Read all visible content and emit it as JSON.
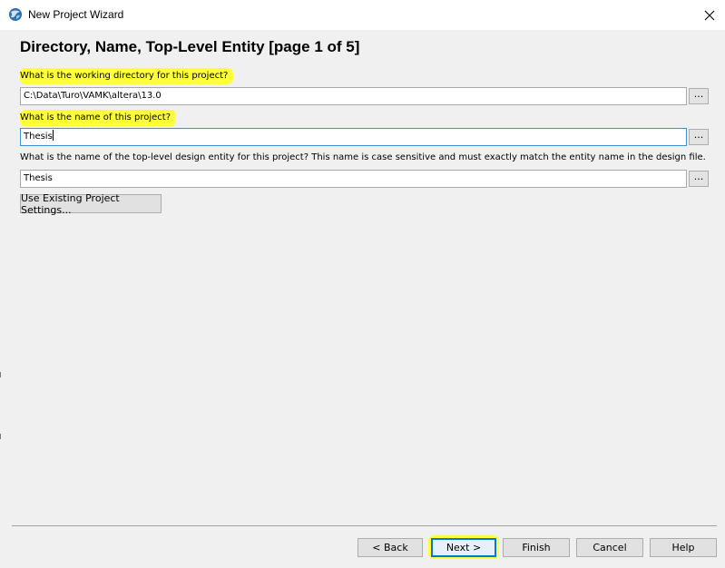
{
  "window": {
    "title": "New Project Wizard",
    "close_glyph": "✕"
  },
  "page": {
    "heading": "Directory, Name, Top-Level Entity [page 1 of 5]"
  },
  "fields": {
    "working_dir": {
      "label": "What is the working directory for this project?",
      "value": "C:\\Data\\Turo\\VAMK\\altera\\13.0",
      "browse_label": "..."
    },
    "project_name": {
      "label": "What is the name of this project?",
      "value": "Thesis",
      "browse_label": "..."
    },
    "top_entity": {
      "label": "What is the name of the top-level design entity for this project? This name is case sensitive and must exactly match the entity name in the design file.",
      "value": "Thesis",
      "browse_label": "..."
    }
  },
  "actions": {
    "use_existing": "Use Existing Project Settings..."
  },
  "footer": {
    "back": "< Back",
    "next": "Next >",
    "finish": "Finish",
    "cancel": "Cancel",
    "help": "Help"
  },
  "colors": {
    "highlight": "#ffff3c",
    "focus_border": "#3c8fd8",
    "accent": "#0078d7"
  },
  "icons": {
    "app": "quartus-globe-icon",
    "close": "close-icon"
  }
}
